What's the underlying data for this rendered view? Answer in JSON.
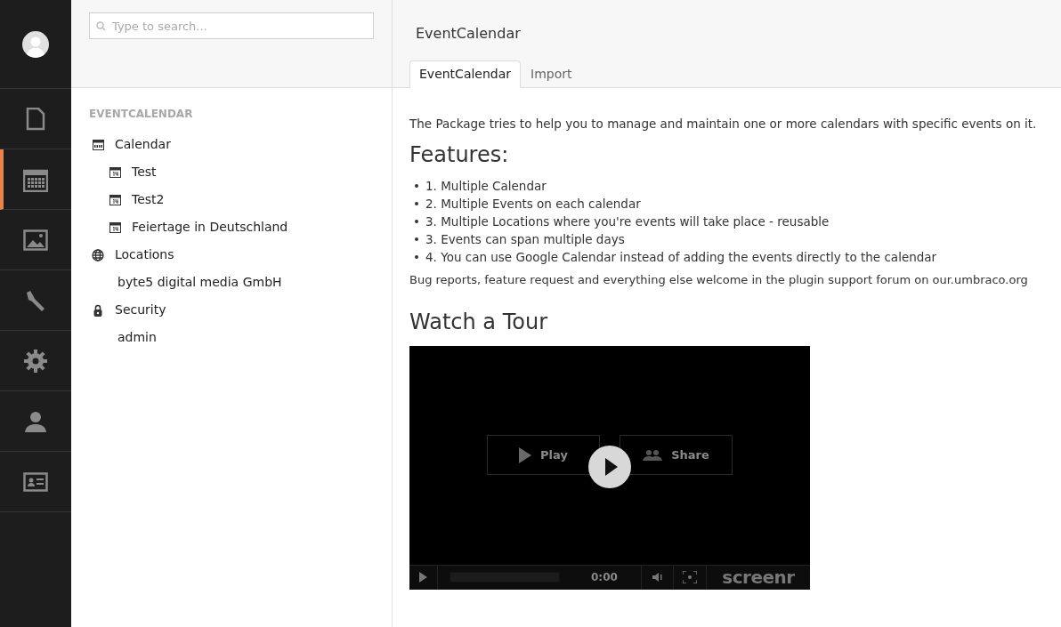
{
  "nav": [
    {
      "kind": "content",
      "selected": false
    },
    {
      "kind": "calendar",
      "selected": true
    },
    {
      "kind": "media",
      "selected": false
    },
    {
      "kind": "developer",
      "selected": false
    },
    {
      "kind": "settings",
      "selected": false
    },
    {
      "kind": "users",
      "selected": false
    },
    {
      "kind": "members",
      "selected": false
    }
  ],
  "search": {
    "placeholder": "Type to search..."
  },
  "tree": {
    "title": "EVENTCALENDAR",
    "items": [
      {
        "label": "Calendar",
        "kind": "calendar",
        "children": [
          {
            "label": "Test",
            "kind": "date"
          },
          {
            "label": "Test2",
            "kind": "date"
          },
          {
            "label": "Feiertage in Deutschland",
            "kind": "date"
          }
        ]
      },
      {
        "label": "Locations",
        "kind": "location",
        "children": [
          {
            "label": "byte5 digital media GmbH",
            "kind": "plain"
          }
        ]
      },
      {
        "label": "Security",
        "kind": "security",
        "children": [
          {
            "label": "admin",
            "kind": "plain"
          }
        ]
      }
    ]
  },
  "editor": {
    "title": "EventCalendar",
    "tabs": [
      {
        "label": "EventCalendar",
        "selected": true
      },
      {
        "label": "Import",
        "selected": false
      }
    ],
    "intro": "The Package tries to help you to manage and maintain one or more calendars with specific events on it.",
    "features_heading": "Features:",
    "features": [
      "1. Multiple Calendar",
      "2. Multiple Events on each calendar",
      "3. Multiple Locations where you're events will take place - reusable",
      "3. Events can span multiple days",
      "4. You can use Google Calendar instead of adding the events directly to the calendar"
    ],
    "note": "Bug reports, feature request and everything else  welcome in the plugin support forum on our.umbraco.org",
    "tour_heading": "Watch a Tour",
    "video": {
      "play": "Play",
      "share": "Share",
      "time": "0:00",
      "brand": "screenr",
      "level": 0
    }
  }
}
